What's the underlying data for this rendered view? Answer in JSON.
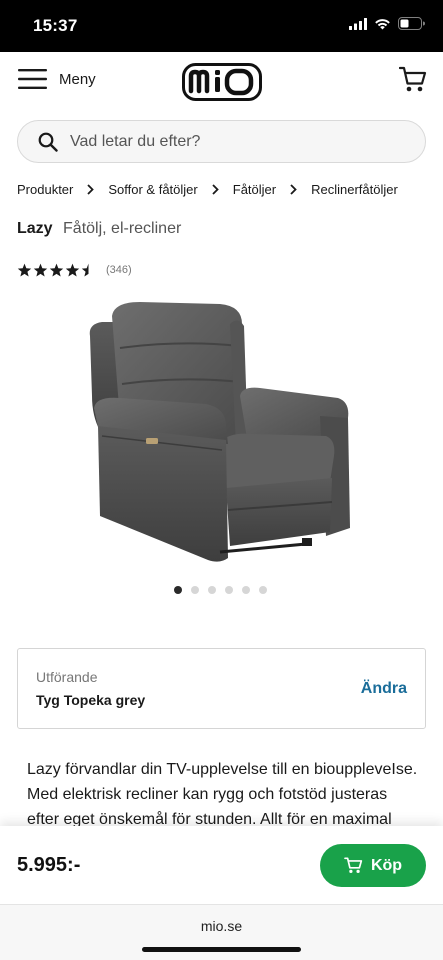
{
  "status_bar": {
    "time": "15:37"
  },
  "header": {
    "menu_label": "Meny",
    "logo_text": "mio"
  },
  "search": {
    "placeholder": "Vad letar du efter?"
  },
  "breadcrumb": [
    "Produkter",
    "Soffor & fåtöljer",
    "Fåtöljer",
    "Reclinerfåtöljer"
  ],
  "product": {
    "name": "Lazy",
    "subtitle": "Fåtölj, el-recliner",
    "rating": 4.5,
    "review_count": "(346)",
    "image_count": 6,
    "active_image": 1
  },
  "variant": {
    "label": "Utförande",
    "value": "Tyg Topeka grey",
    "change_label": "Ändra"
  },
  "description": "Lazy förvandlar din TV-upplevelse till en biouppleveIse. Med elektrisk recliner kan rygg och fotstöd justeras efter eget önskemål för stunden. Allt för en maximal",
  "buy_bar": {
    "price": "5.995:-",
    "buy_label": "Köp"
  },
  "browser": {
    "url": "mio.se"
  },
  "colors": {
    "buy_green": "#19a24a",
    "link_blue": "#1a6d9a"
  }
}
